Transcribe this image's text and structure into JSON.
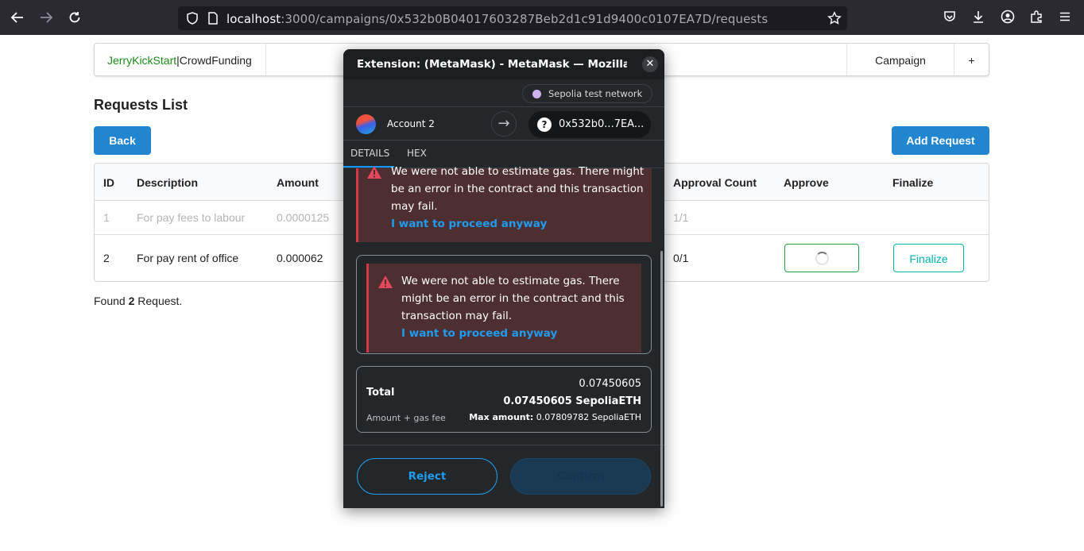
{
  "browser": {
    "url_host": "localhost",
    "url_path": ":3000/campaigns/0x532b0B04017603287Beb2d1c91d9400c0107EA7D/requests"
  },
  "nav": {
    "brand_green": "JerryKickStart",
    "brand_sep": "|",
    "brand_rest": "CrowdFunding",
    "campaign_label": "Campaign",
    "plus_label": "+"
  },
  "page": {
    "title": "Requests List",
    "back_label": "Back",
    "add_request_label": "Add Request",
    "found_prefix": "Found ",
    "found_count": "2",
    "found_suffix": " Request."
  },
  "table": {
    "headers": {
      "id": "ID",
      "description": "Description",
      "amount": "Amount",
      "approval_count": "Approval Count",
      "approve": "Approve",
      "finalize": "Finalize"
    },
    "rows": [
      {
        "id": "1",
        "description": "For pay fees to labour",
        "amount": "0.0000125",
        "approval_count": "1/1"
      },
      {
        "id": "2",
        "description": "For pay rent of office",
        "amount": "0.000062",
        "approval_count": "0/1",
        "finalize_label": "Finalize"
      }
    ]
  },
  "metamask": {
    "window_title": "Extension: (MetaMask) - MetaMask — Mozilla...",
    "network": "Sepolia test network",
    "account_name": "Account 2",
    "recipient": "0x532b0...7EA...",
    "tabs": {
      "details": "DETAILS",
      "hex": "HEX"
    },
    "warning_text": "We were not able to estimate gas. There might be an error in the contract and this transaction may fail.",
    "warning_link": "I want to proceed anyway",
    "total": {
      "label": "Total",
      "sub": "Amount + gas fee",
      "value": "0.07450605",
      "value_bold": "0.07450605 SepoliaETH",
      "max_label": "Max amount:",
      "max_value": " 0.07809782 SepoliaETH"
    },
    "reject_label": "Reject",
    "confirm_label": "Confirm"
  }
}
